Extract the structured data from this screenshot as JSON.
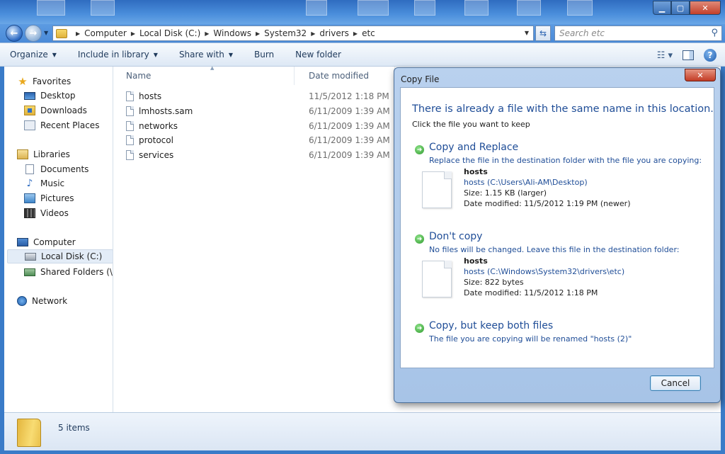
{
  "window": {
    "controls": {
      "minimize": "▁",
      "maximize": "▢",
      "close": "✕"
    }
  },
  "address": {
    "breadcrumbs": [
      "Computer",
      "Local Disk (C:)",
      "Windows",
      "System32",
      "drivers",
      "etc"
    ],
    "search_placeholder": "Search etc"
  },
  "toolbar": {
    "organize": "Organize",
    "include_in_library": "Include in library",
    "share_with": "Share with",
    "burn": "Burn",
    "new_folder": "New folder"
  },
  "nav": {
    "favorites": "Favorites",
    "desktop": "Desktop",
    "downloads": "Downloads",
    "recent_places": "Recent Places",
    "libraries": "Libraries",
    "documents": "Documents",
    "music": "Music",
    "pictures": "Pictures",
    "videos": "Videos",
    "computer": "Computer",
    "local_disk": "Local Disk (C:)",
    "shared_folders": "Shared Folders (\\\\vn",
    "network": "Network"
  },
  "files": {
    "columns": {
      "name": "Name",
      "date_modified": "Date modified"
    },
    "rows": [
      {
        "name": "hosts",
        "date": "11/5/2012 1:18 PM"
      },
      {
        "name": "lmhosts.sam",
        "date": "6/11/2009 1:39 AM"
      },
      {
        "name": "networks",
        "date": "6/11/2009 1:39 AM"
      },
      {
        "name": "protocol",
        "date": "6/11/2009 1:39 AM"
      },
      {
        "name": "services",
        "date": "6/11/2009 1:39 AM"
      }
    ]
  },
  "status": {
    "items_count": "5 items"
  },
  "dialog": {
    "title": "Copy File",
    "heading": "There is already a file with the same name in this location.",
    "subheading": "Click the file you want to keep",
    "options": [
      {
        "title": "Copy and Replace",
        "description": "Replace the file in the destination folder with the file you are copying:",
        "file_name": "hosts",
        "file_path": "hosts (C:\\Users\\Ali-AM\\Desktop)",
        "file_size": "Size: 1.15 KB (larger)",
        "file_date": "Date modified: 11/5/2012 1:19 PM (newer)"
      },
      {
        "title": "Don't copy",
        "description": "No files will be changed. Leave this file in the destination folder:",
        "file_name": "hosts",
        "file_path": "hosts (C:\\Windows\\System32\\drivers\\etc)",
        "file_size": "Size: 822 bytes",
        "file_date": "Date modified: 11/5/2012 1:18 PM"
      },
      {
        "title": "Copy, but keep both files",
        "description": "The file you are copying will be renamed \"hosts (2)\""
      }
    ],
    "cancel": "Cancel"
  }
}
